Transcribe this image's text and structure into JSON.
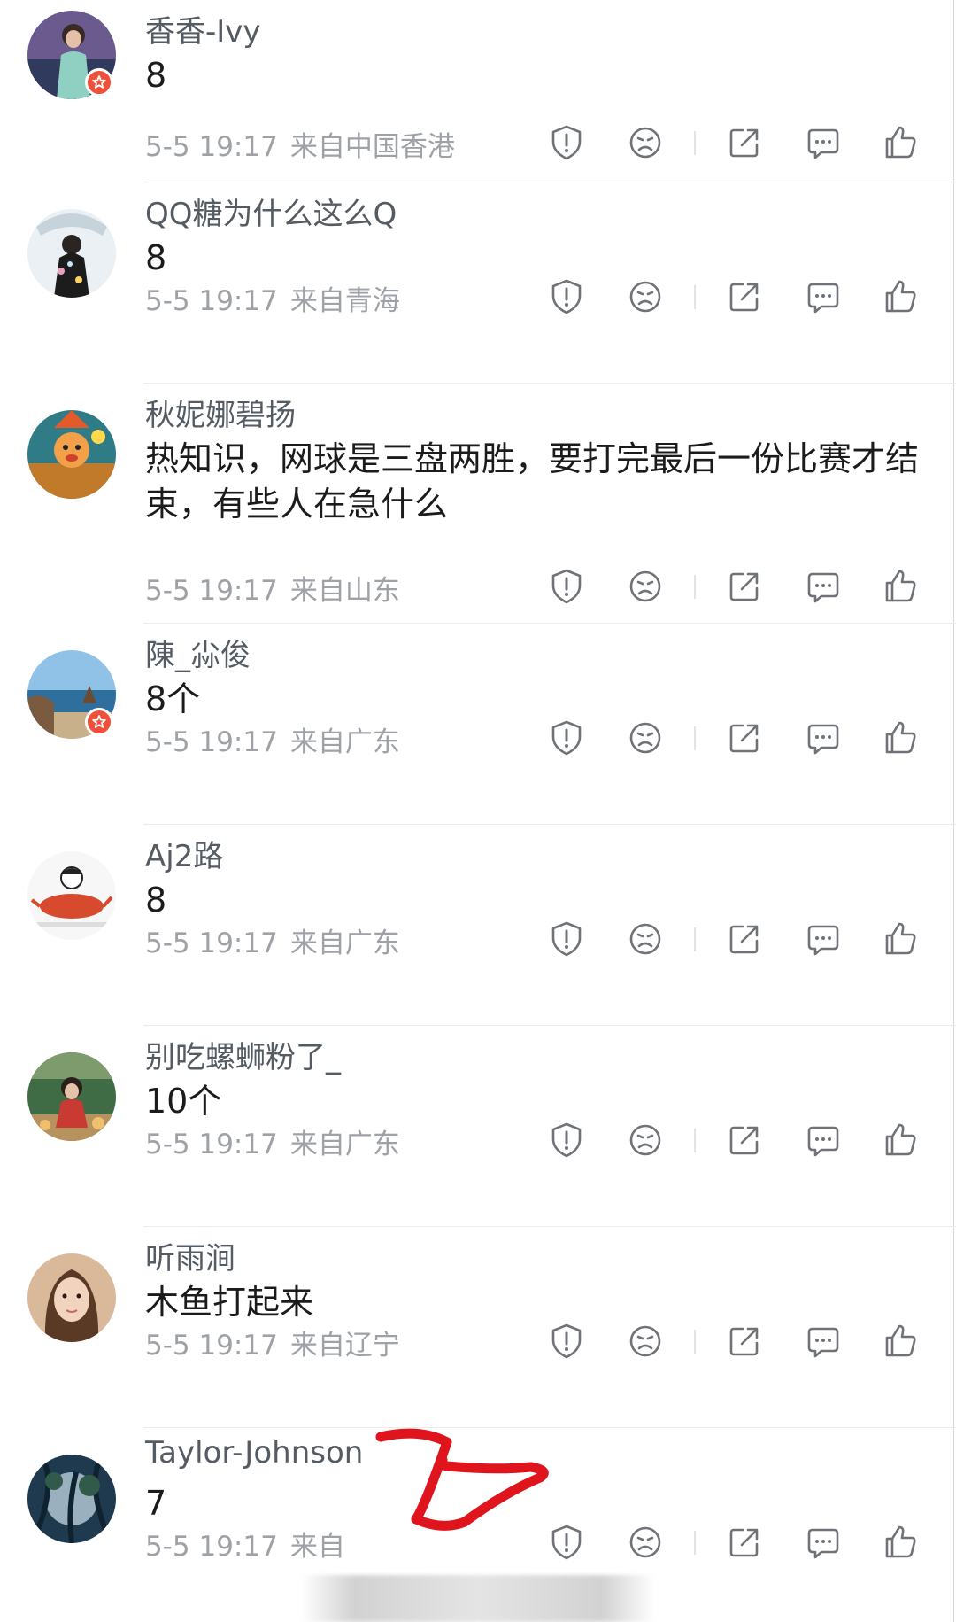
{
  "comments": [
    {
      "username": "香香-Ivy",
      "content": "8",
      "time": "5-5 19:17",
      "location": "来自中国香港",
      "verified": true
    },
    {
      "username": "QQ糖为什么这么Q",
      "content": "8",
      "time": "5-5 19:17",
      "location": "来自青海",
      "verified": false
    },
    {
      "username": "秋妮娜碧扬",
      "content": "热知识，网球是三盘两胜，要打完最后一份比赛才结束，有些人在急什么",
      "time": "5-5 19:17",
      "location": "来自山东",
      "verified": false
    },
    {
      "username": "陳_尛俊",
      "content": "8个",
      "time": "5-5 19:17",
      "location": "来自广东",
      "verified": true
    },
    {
      "username": "Aj2路",
      "content": "8",
      "time": "5-5 19:17",
      "location": "来自广东",
      "verified": false
    },
    {
      "username": "别吃螺蛳粉了_",
      "content": "10个",
      "time": "5-5 19:17",
      "location": "来自广东",
      "verified": false
    },
    {
      "username": "听雨涧",
      "content": "木鱼打起来",
      "time": "5-5 19:17",
      "location": "来自辽宁",
      "verified": false
    },
    {
      "username": "Taylor-Johnson",
      "content": "7",
      "time": "5-5 19:17",
      "location": "来自",
      "verified": false
    }
  ],
  "icons": {
    "report": "report-icon",
    "dislike": "dislike-icon",
    "share": "share-icon",
    "reply": "reply-icon",
    "like": "like-icon",
    "verified": "verified-badge-icon"
  },
  "colors": {
    "username": "#555b63",
    "content": "#1b1b1b",
    "meta": "#9ea2a7",
    "icon": "#6f7378",
    "badge": "#f0503a",
    "annotation": "#e0141c"
  }
}
